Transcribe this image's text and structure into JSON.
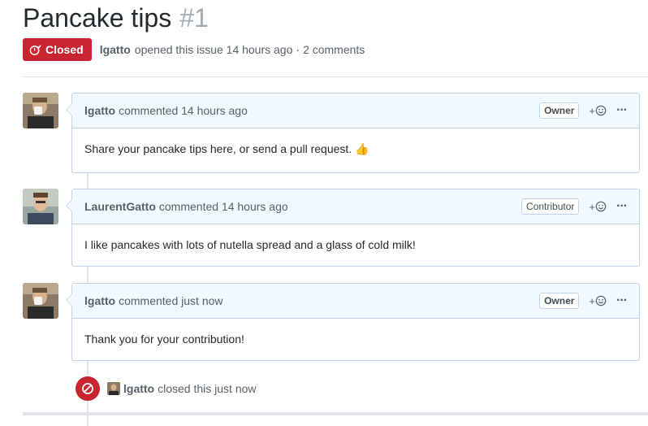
{
  "issue": {
    "title": "Pancake tips",
    "number": "#1",
    "state": "Closed",
    "author": "lgatto",
    "opened_text": "opened this issue 14 hours ago",
    "separator": "·",
    "comments_count": "2 comments"
  },
  "comments": [
    {
      "author": "lgatto",
      "action": "commented 14 hours ago",
      "role": "Owner",
      "body": "Share your pancake tips here, or send a pull request. 👍",
      "avatar": "avatar-lgatto"
    },
    {
      "author": "LaurentGatto",
      "action": "commented 14 hours ago",
      "role": "Contributor",
      "body": "I like pancakes with lots of nutella spread and a glass of cold milk!",
      "avatar": "avatar-laurentgatto"
    },
    {
      "author": "lgatto",
      "action": "commented just now",
      "role": "Owner",
      "body": "Thank you for your contribution!",
      "avatar": "avatar-lgatto"
    }
  ],
  "event": {
    "author": "lgatto",
    "text": "closed this just now",
    "icon": "circle-slash-icon"
  },
  "ui": {
    "reaction_plus": "+",
    "more": "···"
  },
  "colors": {
    "closed_red": "#cb2431",
    "header_blue": "#f1f8ff",
    "border_blue": "#c0d3eb"
  }
}
